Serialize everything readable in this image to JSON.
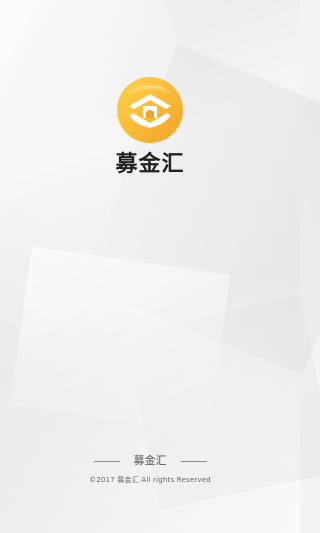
{
  "app": {
    "name": "募金汇"
  },
  "footer": {
    "title": "募金汇",
    "copyright": "©2017 募金汇 All rights Reserved"
  },
  "icons": {
    "logo": "mujinhui-logo-icon"
  },
  "colors": {
    "logo_orange": "#F2A12A",
    "logo_yellow": "#FFD34D",
    "text_dark": "#222222",
    "text_gray": "#666666"
  }
}
